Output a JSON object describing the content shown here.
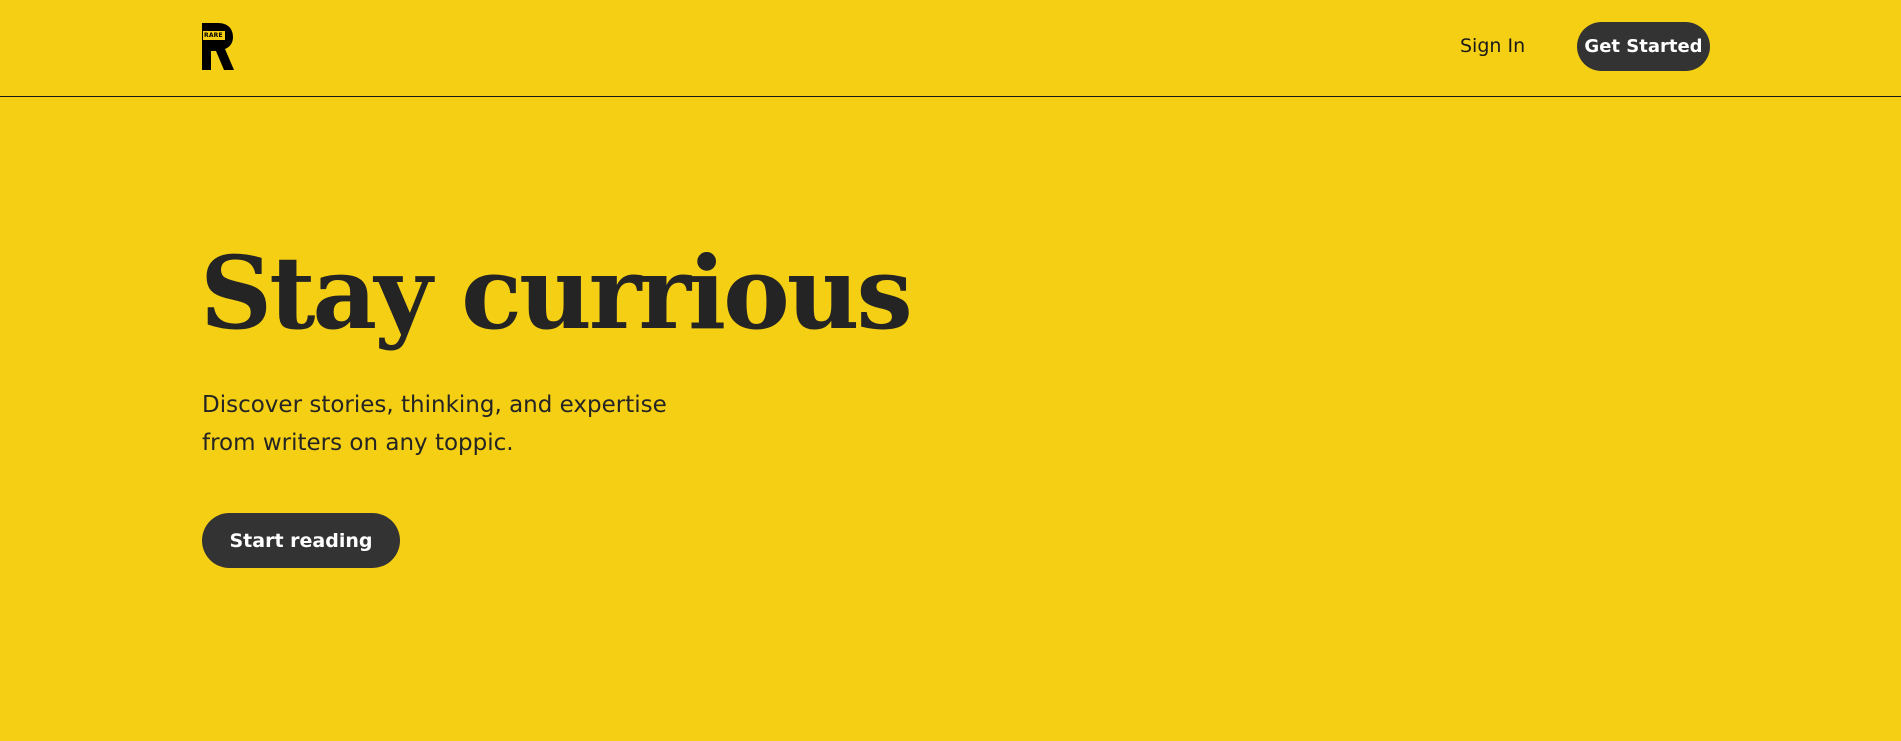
{
  "header": {
    "logo_label": "RARE",
    "sign_in_label": "Sign In",
    "get_started_label": "Get Started"
  },
  "hero": {
    "title": "Stay currious",
    "subtitle_line1": "Discover stories, thinking, and expertise",
    "subtitle_line2": "from writers on any toppic.",
    "cta_label": "Start reading"
  },
  "colors": {
    "background": "#F4CF14",
    "button": "#333333",
    "button_text": "#FFFFFF",
    "text": "#242424"
  },
  "icons": {
    "logo": "r-logo-icon"
  }
}
